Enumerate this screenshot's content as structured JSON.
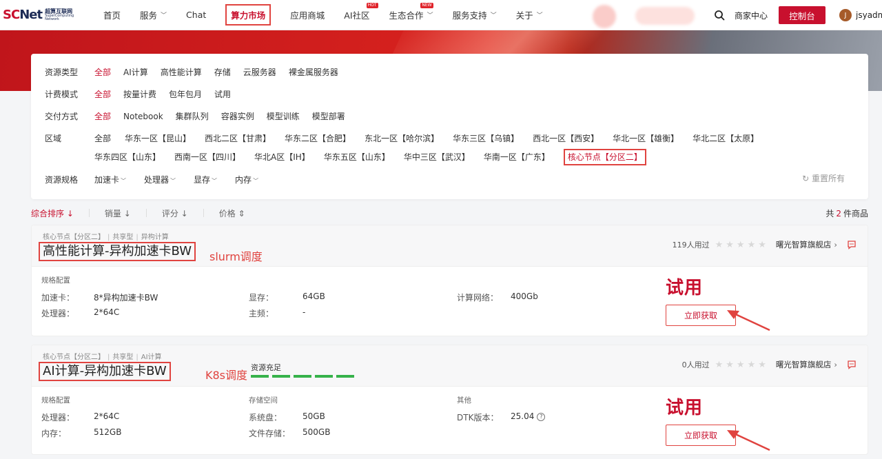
{
  "header": {
    "logo_text_main": "SC",
    "logo_text_net": "Net",
    "logo_sub_zh": "超算互联网",
    "logo_sub_en1": "SuperComputing",
    "logo_sub_en2": "Network",
    "nav": [
      {
        "label": "首页"
      },
      {
        "label": "服务",
        "chevron": true
      },
      {
        "label": "Chat"
      },
      {
        "label": "算力市场",
        "active": true
      },
      {
        "label": "应用商城"
      },
      {
        "label": "AI社区",
        "badge": "HOT"
      },
      {
        "label": "生态合作",
        "badge": "NEW",
        "chevron": true
      },
      {
        "label": "服务支持",
        "chevron": true
      },
      {
        "label": "关于",
        "chevron": true
      }
    ],
    "merchant_center": "商家中心",
    "console_button": "控制台",
    "avatar_initial": "J",
    "username": "jsyadmin"
  },
  "filters": {
    "resource_type": {
      "label": "资源类型",
      "options": [
        "全部",
        "AI计算",
        "高性能计算",
        "存储",
        "云服务器",
        "裸金属服务器"
      ],
      "selected": "全部"
    },
    "billing_mode": {
      "label": "计费模式",
      "options": [
        "全部",
        "按量计费",
        "包年包月",
        "试用"
      ],
      "selected": "全部"
    },
    "delivery_mode": {
      "label": "交付方式",
      "options": [
        "全部",
        "Notebook",
        "集群队列",
        "容器实例",
        "模型训练",
        "模型部署"
      ],
      "selected": "全部"
    },
    "region": {
      "label": "区域",
      "options": [
        "全部",
        "华东一区【昆山】",
        "西北二区【甘肃】",
        "华东二区【合肥】",
        "东北一区【哈尔滨】",
        "华东三区【乌镇】",
        "西北一区【西安】",
        "华北一区【雄衡】",
        "华北二区【太原】",
        "华东四区【山东】",
        "西南一区【四川】",
        "华北A区【IH】",
        "华东五区【山东】",
        "华中三区【武汉】",
        "华南一区【广东】",
        "核心节点【分区二】"
      ],
      "selected": "核心节点【分区二】"
    },
    "spec": {
      "label": "资源规格",
      "options": [
        "加速卡",
        "处理器",
        "显存",
        "内存"
      ]
    },
    "reset": "重置所有"
  },
  "sort": {
    "items": [
      {
        "label": "综合排序",
        "arrow": "↓",
        "active": true
      },
      {
        "label": "销量",
        "arrow": "↓"
      },
      {
        "label": "评分",
        "arrow": "↓"
      },
      {
        "label": "价格",
        "arrow": "⇕"
      }
    ],
    "count_prefix": "共",
    "count": "2",
    "count_suffix": "件商品"
  },
  "products": [
    {
      "tags": [
        "核心节点【分区二】",
        "共享型",
        "异构计算"
      ],
      "title": "高性能计算-异构加速卡BW",
      "annotation": "slurm调度",
      "used": "119人用过",
      "shop": "曙光智算旗舰店",
      "section1": "规格配置",
      "rows": [
        {
          "k": "加速卡：",
          "v": "8*异构加速卡BW"
        },
        {
          "k": "处理器：",
          "v": "2*64C"
        },
        {
          "k": "显存：",
          "v": "64GB"
        },
        {
          "k": "主频：",
          "v": "-"
        },
        {
          "k": "计算网络：",
          "v": "400Gb"
        }
      ],
      "trial": "试用",
      "button": "立即获取"
    },
    {
      "tags": [
        "核心节点【分区二】",
        "共享型",
        "AI计算"
      ],
      "title": "AI计算-异构加速卡BW",
      "annotation": "K8s调度",
      "stock": "资源充足",
      "stock_level": 1.0,
      "used": "0人用过",
      "shop": "曙光智算旗舰店",
      "section1": "规格配置",
      "section2": "存储空间",
      "section3": "其他",
      "rows": [
        {
          "k": "处理器：",
          "v": "2*64C"
        },
        {
          "k": "内存：",
          "v": "512GB"
        },
        {
          "k": "系统盘：",
          "v": "50GB"
        },
        {
          "k": "文件存储：",
          "v": "500GB"
        },
        {
          "k": "DTK版本：",
          "v": "25.04"
        }
      ],
      "trial": "试用",
      "button": "立即获取"
    }
  ],
  "colors": {
    "brand": "#c8102e",
    "annotation": "#e0433f",
    "stock": "#36b24a"
  }
}
